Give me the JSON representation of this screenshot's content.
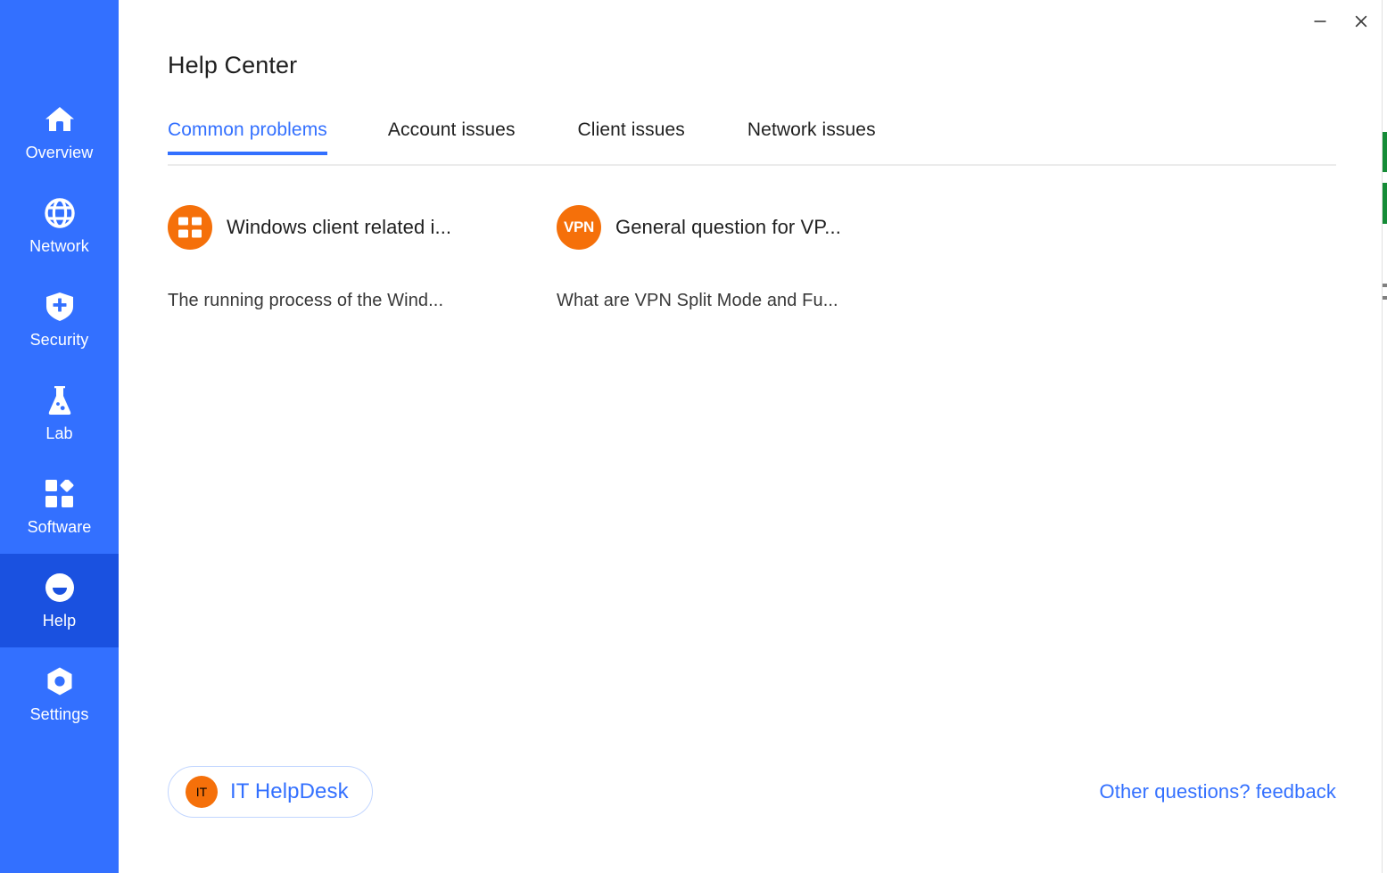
{
  "window": {
    "minimize_label": "−",
    "close_label": "✕"
  },
  "sidebar": {
    "background_color": "#3370ff",
    "active_background_color": "#1a51e0",
    "items": [
      {
        "id": "overview",
        "label": "Overview",
        "icon": "home-icon",
        "active": false
      },
      {
        "id": "network",
        "label": "Network",
        "icon": "globe-icon",
        "active": false
      },
      {
        "id": "security",
        "label": "Security",
        "icon": "shield-plus-icon",
        "active": false
      },
      {
        "id": "lab",
        "label": "Lab",
        "icon": "flask-icon",
        "active": false
      },
      {
        "id": "software",
        "label": "Software",
        "icon": "apps-grid-icon",
        "active": false
      },
      {
        "id": "help",
        "label": "Help",
        "icon": "help-face-icon",
        "active": true
      },
      {
        "id": "settings",
        "label": "Settings",
        "icon": "hex-gear-icon",
        "active": false
      }
    ]
  },
  "header": {
    "title": "Help Center"
  },
  "tabs": {
    "accent_color": "#3370ff",
    "items": [
      {
        "id": "common-problems",
        "label": "Common problems",
        "active": true
      },
      {
        "id": "account-issues",
        "label": "Account issues",
        "active": false
      },
      {
        "id": "client-issues",
        "label": "Client issues",
        "active": false
      },
      {
        "id": "network-issues",
        "label": "Network issues",
        "active": false
      }
    ]
  },
  "main": {
    "badge_color": "#f5700a",
    "cards": [
      {
        "id": "windows-client",
        "icon": "apps-grid-icon",
        "icon_text": "",
        "title": "Windows client related i...",
        "description": "The running process of the Wind..."
      },
      {
        "id": "vpn-general",
        "icon": "vpn-badge-icon",
        "icon_text": "VPN",
        "title": "General question for VP...",
        "description": "What are VPN Split Mode and Fu..."
      }
    ]
  },
  "footer": {
    "helpdesk": {
      "icon": "it-badge-icon",
      "icon_text": "IT",
      "label": "IT HelpDesk"
    },
    "feedback_link": "Other questions? feedback"
  }
}
